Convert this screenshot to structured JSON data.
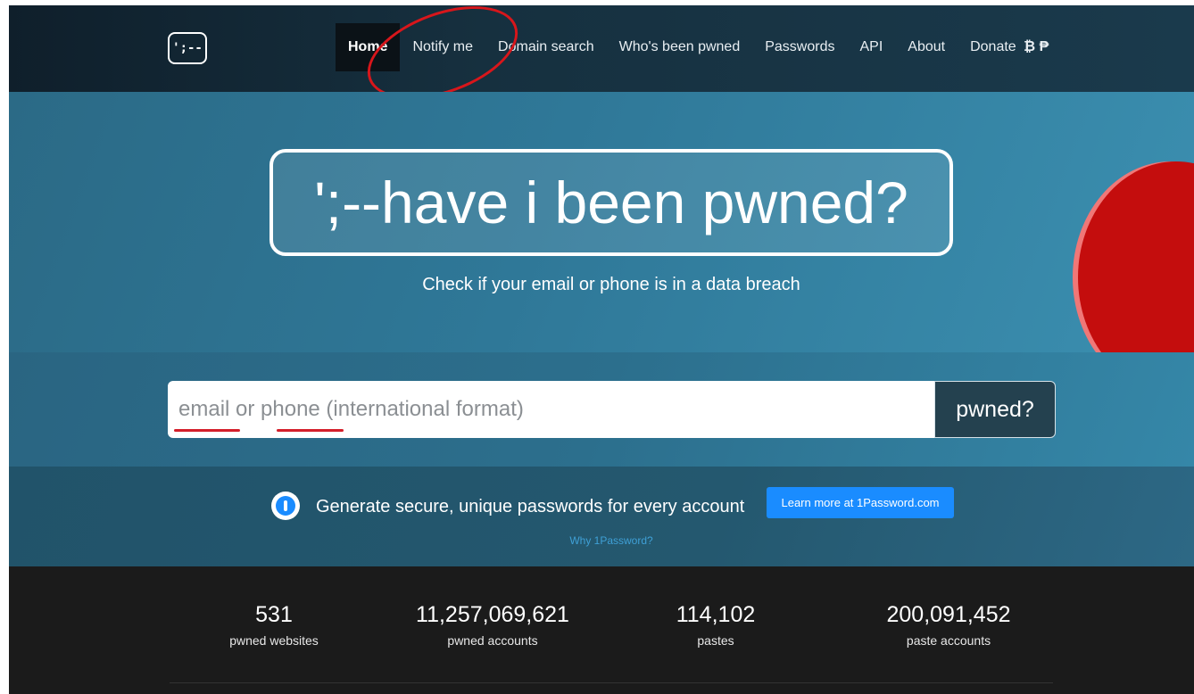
{
  "logo": {
    "text": "';--"
  },
  "nav": {
    "items": [
      {
        "label": "Home",
        "active": true
      },
      {
        "label": "Notify me"
      },
      {
        "label": "Domain search"
      },
      {
        "label": "Who's been pwned"
      },
      {
        "label": "Passwords"
      },
      {
        "label": "API"
      },
      {
        "label": "About"
      },
      {
        "label": "Donate",
        "icons": [
          "bitcoin-icon",
          "paypal-icon"
        ],
        "icon_text": "₿ ₱"
      }
    ]
  },
  "hero": {
    "title": "';--have i been pwned?",
    "tagline": "Check if your email or phone is in a data breach"
  },
  "search": {
    "placeholder": "email or phone (international format)",
    "button_label": "pwned?"
  },
  "promo": {
    "text": "Generate secure, unique passwords for every account",
    "button_label": "Learn more at 1Password.com",
    "link_label": "Why 1Password?"
  },
  "stats": [
    {
      "value": "531",
      "label": "pwned websites"
    },
    {
      "value": "11,257,069,621",
      "label": "pwned accounts"
    },
    {
      "value": "114,102",
      "label": "pastes"
    },
    {
      "value": "200,091,452",
      "label": "paste accounts"
    }
  ],
  "colors": {
    "annotation": "#d8161b",
    "accent": "#1a8cff",
    "button_dark": "#24414f"
  }
}
